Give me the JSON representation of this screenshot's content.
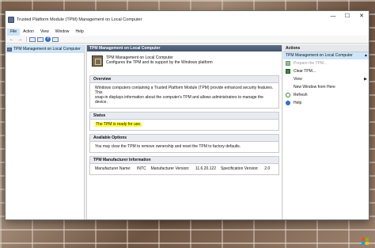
{
  "window": {
    "title": "Trusted Platform Module (TPM) Management on Local Computer",
    "controls": {
      "minimize": "—",
      "maximize": "☐",
      "close": "✕"
    }
  },
  "menu": [
    "File",
    "Action",
    "View",
    "Window",
    "Help"
  ],
  "tree": {
    "root_label": "TPM Management on Local Computer"
  },
  "main": {
    "header": "TPM Management on Local Computer",
    "intro_line1": "TPM Management on Local Computer",
    "intro_line2": "Configures the TPM and its support by the Windows platform",
    "overview": {
      "title": "Overview",
      "text_line1": "Windows computers containing a Trusted Platform Module (TPM) provide enhanced security features. This",
      "text_line2": "snap-in displays information about the computer's TPM and allows administrators to manage the device."
    },
    "status": {
      "title": "Status",
      "text": "The TPM is ready for use."
    },
    "available_options": {
      "title": "Available Options",
      "text": "You may clear the TPM to remove ownership and reset the TPM to factory defaults."
    },
    "manufacturer": {
      "title": "TPM Manufacturer Information",
      "name_label": "Manufacturer Name:",
      "name_value": "INTC",
      "version_label": "Manufacturer Version:",
      "version_value": "11.6.20.122",
      "spec_label": "Specification Version:",
      "spec_value": "2.0"
    }
  },
  "actions": {
    "header": "Actions",
    "subheader": "TPM Management on Local Computer",
    "items": [
      {
        "label": "Prepare the TPM...",
        "icon": "tpm-icon",
        "disabled": true
      },
      {
        "label": "Clear TPM...",
        "icon": "tpm-icon",
        "disabled": false
      },
      {
        "label": "View",
        "icon": "none",
        "disabled": false
      },
      {
        "label": "New Window from Here",
        "icon": "none",
        "disabled": false
      },
      {
        "label": "Refresh",
        "icon": "refresh-icon",
        "disabled": false
      },
      {
        "label": "Help",
        "icon": "help-icon",
        "disabled": false
      }
    ]
  },
  "colors": {
    "status_highlight": "#ffff3a",
    "selection": "#cde5f9",
    "header_bar": "#44556c"
  }
}
